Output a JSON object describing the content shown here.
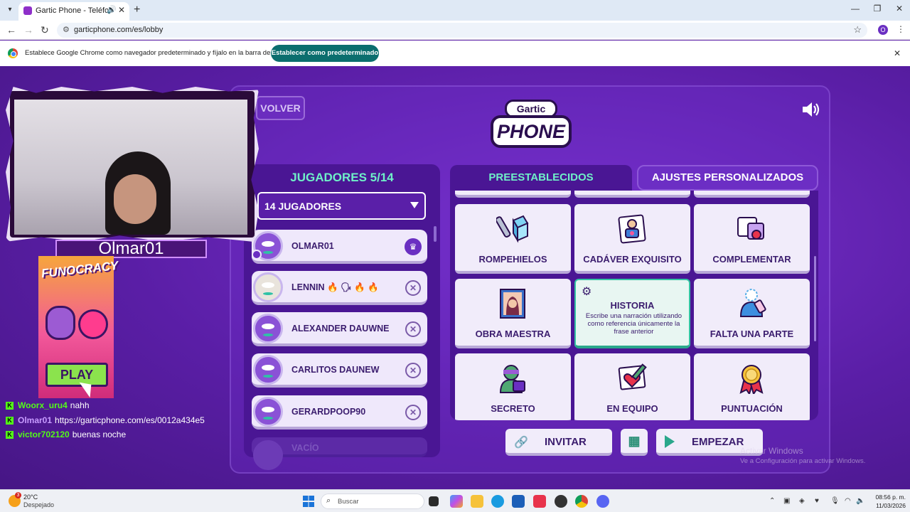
{
  "browser": {
    "tab_title": "Gartic Phone - Teléfono De",
    "url": "garticphone.com/es/lobby",
    "profile_initial": "O",
    "infobar_text": "Establece Google Chrome como navegador predeterminado y fíjalo en la barra de tareas",
    "infobar_button": "Establecer como predeterminado"
  },
  "lobby": {
    "back_label": "VOLVER",
    "logo_top": "Gartic",
    "logo_main": "PHONE",
    "players_title": "JUGADORES 5/14",
    "players_select": "14 JUGADORES",
    "players": [
      {
        "name": "OLMAR01",
        "badge": "♛"
      },
      {
        "name": "LENNIN 🔥 🗣 🔥 🔥",
        "badge": "✕"
      },
      {
        "name": "ALEXANDER DAUWNE",
        "badge": "✕"
      },
      {
        "name": "CARLITOS DAUNEW",
        "badge": "✕"
      },
      {
        "name": "GERARDPOOP90",
        "badge": "✕"
      }
    ],
    "empty_slot": "VACÍO",
    "tabs": {
      "preset": "PREESTABLECIDOS",
      "custom": "AJUSTES PERSONALIZADOS"
    },
    "modes": [
      {
        "label": "ROMPEHIELOS",
        "icon": "hammer-cube-icon"
      },
      {
        "label": "CADÁVER EXQUISITO",
        "icon": "portrait-icon"
      },
      {
        "label": "COMPLEMENTAR",
        "icon": "puzzle-heart-icon"
      },
      {
        "label": "OBRA MAESTRA",
        "icon": "mona-lisa-icon"
      },
      {
        "label": "HISTORIA",
        "icon": "gear-icon",
        "description": "Escribe una narración utilizando como referencia únicamente la frase anterior"
      },
      {
        "label": "FALTA UNA PARTE",
        "icon": "broken-figure-icon"
      },
      {
        "label": "SECRETO",
        "icon": "ninja-icon"
      },
      {
        "label": "EN EQUIPO",
        "icon": "pencils-heart-icon"
      },
      {
        "label": "PUNTUACIÓN",
        "icon": "medal-icon"
      }
    ],
    "actions": {
      "invite": "INVITAR",
      "start": "EMPEZAR"
    }
  },
  "overlay": {
    "streamer_name": "Olmar01",
    "ad_title": "FUNOCRACY",
    "ad_play": "PLAY",
    "chat": [
      {
        "user": "Woorx_uru4",
        "msg": "nahh"
      },
      {
        "user": "Olmar01",
        "msg": "https://garticphone.com/es/0012a434e5"
      },
      {
        "user": "victor702120",
        "msg": "buenas noche"
      }
    ]
  },
  "watermark": {
    "line1": "Activar Windows",
    "line2": "Ve a Configuración para activar Windows."
  },
  "taskbar": {
    "temp": "20°C",
    "weather": "Despejado",
    "weather_badge": "3",
    "search": "Buscar",
    "time": "08:56 p. m.",
    "date": "11/03/2026"
  }
}
